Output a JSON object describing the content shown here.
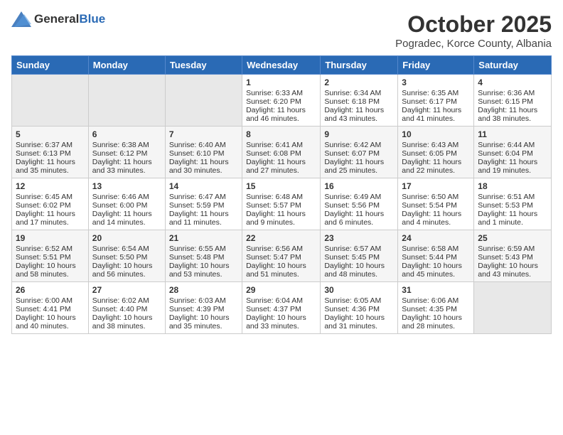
{
  "header": {
    "logo_general": "General",
    "logo_blue": "Blue",
    "month": "October 2025",
    "location": "Pogradec, Korce County, Albania"
  },
  "weekdays": [
    "Sunday",
    "Monday",
    "Tuesday",
    "Wednesday",
    "Thursday",
    "Friday",
    "Saturday"
  ],
  "weeks": [
    [
      {
        "day": "",
        "info": ""
      },
      {
        "day": "",
        "info": ""
      },
      {
        "day": "",
        "info": ""
      },
      {
        "day": "1",
        "info": "Sunrise: 6:33 AM\nSunset: 6:20 PM\nDaylight: 11 hours and 46 minutes."
      },
      {
        "day": "2",
        "info": "Sunrise: 6:34 AM\nSunset: 6:18 PM\nDaylight: 11 hours and 43 minutes."
      },
      {
        "day": "3",
        "info": "Sunrise: 6:35 AM\nSunset: 6:17 PM\nDaylight: 11 hours and 41 minutes."
      },
      {
        "day": "4",
        "info": "Sunrise: 6:36 AM\nSunset: 6:15 PM\nDaylight: 11 hours and 38 minutes."
      }
    ],
    [
      {
        "day": "5",
        "info": "Sunrise: 6:37 AM\nSunset: 6:13 PM\nDaylight: 11 hours and 35 minutes."
      },
      {
        "day": "6",
        "info": "Sunrise: 6:38 AM\nSunset: 6:12 PM\nDaylight: 11 hours and 33 minutes."
      },
      {
        "day": "7",
        "info": "Sunrise: 6:40 AM\nSunset: 6:10 PM\nDaylight: 11 hours and 30 minutes."
      },
      {
        "day": "8",
        "info": "Sunrise: 6:41 AM\nSunset: 6:08 PM\nDaylight: 11 hours and 27 minutes."
      },
      {
        "day": "9",
        "info": "Sunrise: 6:42 AM\nSunset: 6:07 PM\nDaylight: 11 hours and 25 minutes."
      },
      {
        "day": "10",
        "info": "Sunrise: 6:43 AM\nSunset: 6:05 PM\nDaylight: 11 hours and 22 minutes."
      },
      {
        "day": "11",
        "info": "Sunrise: 6:44 AM\nSunset: 6:04 PM\nDaylight: 11 hours and 19 minutes."
      }
    ],
    [
      {
        "day": "12",
        "info": "Sunrise: 6:45 AM\nSunset: 6:02 PM\nDaylight: 11 hours and 17 minutes."
      },
      {
        "day": "13",
        "info": "Sunrise: 6:46 AM\nSunset: 6:00 PM\nDaylight: 11 hours and 14 minutes."
      },
      {
        "day": "14",
        "info": "Sunrise: 6:47 AM\nSunset: 5:59 PM\nDaylight: 11 hours and 11 minutes."
      },
      {
        "day": "15",
        "info": "Sunrise: 6:48 AM\nSunset: 5:57 PM\nDaylight: 11 hours and 9 minutes."
      },
      {
        "day": "16",
        "info": "Sunrise: 6:49 AM\nSunset: 5:56 PM\nDaylight: 11 hours and 6 minutes."
      },
      {
        "day": "17",
        "info": "Sunrise: 6:50 AM\nSunset: 5:54 PM\nDaylight: 11 hours and 4 minutes."
      },
      {
        "day": "18",
        "info": "Sunrise: 6:51 AM\nSunset: 5:53 PM\nDaylight: 11 hours and 1 minute."
      }
    ],
    [
      {
        "day": "19",
        "info": "Sunrise: 6:52 AM\nSunset: 5:51 PM\nDaylight: 10 hours and 58 minutes."
      },
      {
        "day": "20",
        "info": "Sunrise: 6:54 AM\nSunset: 5:50 PM\nDaylight: 10 hours and 56 minutes."
      },
      {
        "day": "21",
        "info": "Sunrise: 6:55 AM\nSunset: 5:48 PM\nDaylight: 10 hours and 53 minutes."
      },
      {
        "day": "22",
        "info": "Sunrise: 6:56 AM\nSunset: 5:47 PM\nDaylight: 10 hours and 51 minutes."
      },
      {
        "day": "23",
        "info": "Sunrise: 6:57 AM\nSunset: 5:45 PM\nDaylight: 10 hours and 48 minutes."
      },
      {
        "day": "24",
        "info": "Sunrise: 6:58 AM\nSunset: 5:44 PM\nDaylight: 10 hours and 45 minutes."
      },
      {
        "day": "25",
        "info": "Sunrise: 6:59 AM\nSunset: 5:43 PM\nDaylight: 10 hours and 43 minutes."
      }
    ],
    [
      {
        "day": "26",
        "info": "Sunrise: 6:00 AM\nSunset: 4:41 PM\nDaylight: 10 hours and 40 minutes."
      },
      {
        "day": "27",
        "info": "Sunrise: 6:02 AM\nSunset: 4:40 PM\nDaylight: 10 hours and 38 minutes."
      },
      {
        "day": "28",
        "info": "Sunrise: 6:03 AM\nSunset: 4:39 PM\nDaylight: 10 hours and 35 minutes."
      },
      {
        "day": "29",
        "info": "Sunrise: 6:04 AM\nSunset: 4:37 PM\nDaylight: 10 hours and 33 minutes."
      },
      {
        "day": "30",
        "info": "Sunrise: 6:05 AM\nSunset: 4:36 PM\nDaylight: 10 hours and 31 minutes."
      },
      {
        "day": "31",
        "info": "Sunrise: 6:06 AM\nSunset: 4:35 PM\nDaylight: 10 hours and 28 minutes."
      },
      {
        "day": "",
        "info": ""
      }
    ]
  ]
}
